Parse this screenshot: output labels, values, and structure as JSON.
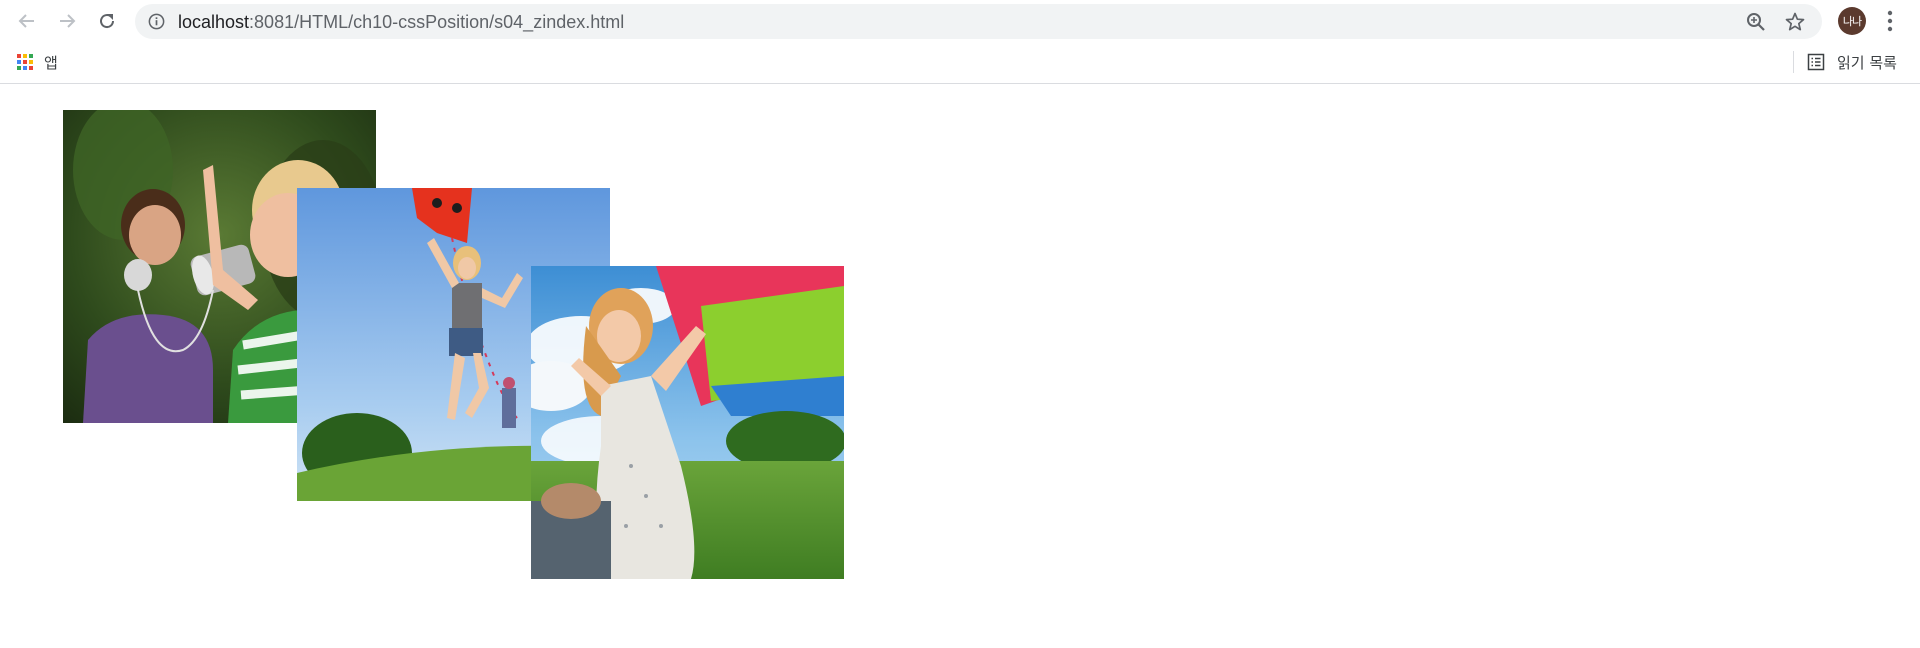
{
  "browser": {
    "url_host": "localhost",
    "url_path": ":8081/HTML/ch10-cssPosition/s04_zindex.html",
    "profile_initials": "나나",
    "icons": {
      "back": "arrow-left-icon",
      "forward": "arrow-right-icon",
      "reload": "reload-icon",
      "site_info": "info-circle-icon",
      "zoom": "zoom-in-icon",
      "bookmark": "star-icon",
      "menu": "vertical-dots-icon",
      "apps": "apps-grid-icon",
      "reading_list": "reading-list-icon"
    }
  },
  "bookmarks_bar": {
    "apps_label": "앱",
    "reading_list_label": "읽기 목록"
  },
  "page": {
    "photos": [
      {
        "name": "photo-boys-tin-can-phone",
        "z_order": 1
      },
      {
        "name": "photo-girl-kite-jump",
        "z_order": 2
      },
      {
        "name": "photo-girl-with-kite",
        "z_order": 3
      }
    ]
  }
}
